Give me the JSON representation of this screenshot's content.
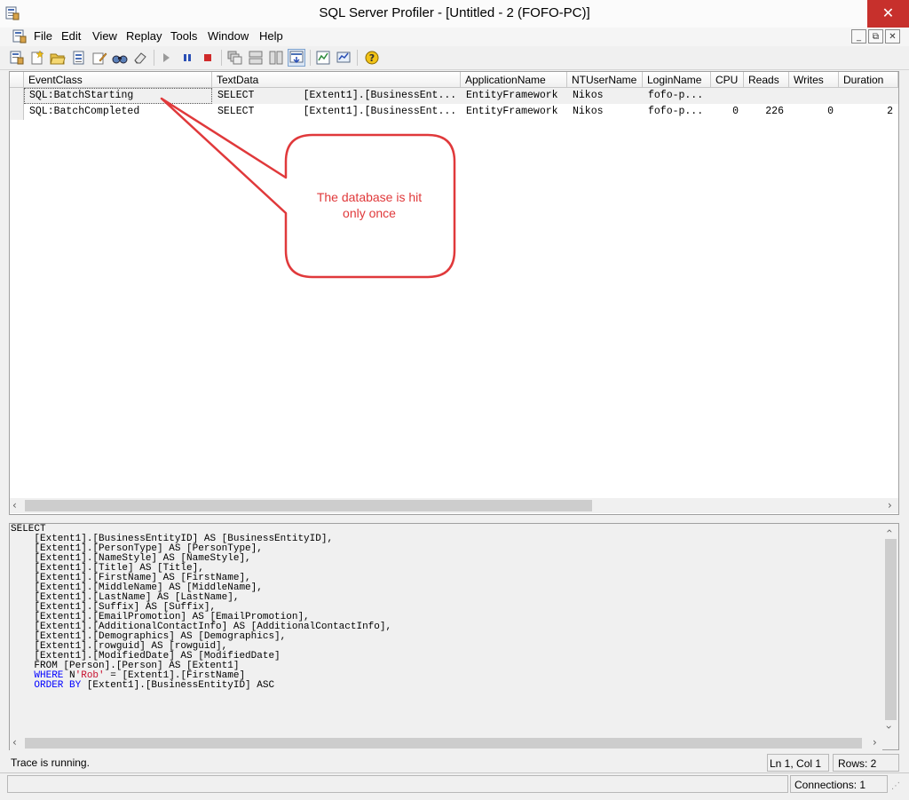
{
  "window": {
    "title": "SQL Server Profiler - [Untitled - 2 (FOFO-PC)]",
    "close_glyph": "✕"
  },
  "menu": {
    "items": [
      "File",
      "Edit",
      "View",
      "Replay",
      "Tools",
      "Window",
      "Help"
    ],
    "mdi_buttons": [
      "_",
      "⧉",
      "✕"
    ]
  },
  "toolbar": {
    "icons": [
      "new-trace-icon",
      "new-template-icon",
      "open-icon",
      "properties-icon",
      "find-icon",
      "clear-icon",
      "run-icon",
      "pause-icon",
      "stop-icon",
      "auto-scroll-icon",
      "help-icon"
    ]
  },
  "grid": {
    "columns": [
      "EventClass",
      "TextData",
      "ApplicationName",
      "NTUserName",
      "LoginName",
      "CPU",
      "Reads",
      "Writes",
      "Duration"
    ],
    "rows": [
      {
        "event_class": "SQL:BatchStarting",
        "text_data": "SELECT        [Extent1].[BusinessEnt...",
        "application_name": "EntityFramework",
        "nt_user_name": "Nikos",
        "login_name": "fofo-p...",
        "cpu": "",
        "reads": "",
        "writes": "",
        "duration": ""
      },
      {
        "event_class": "SQL:BatchCompleted",
        "text_data": "SELECT        [Extent1].[BusinessEnt...",
        "application_name": "EntityFramework",
        "nt_user_name": "Nikos",
        "login_name": "fofo-p...",
        "cpu": "0",
        "reads": "226",
        "writes": "0",
        "duration": "2"
      }
    ]
  },
  "callout": {
    "text_line1": "The database is hit",
    "text_line2": "only once",
    "color": "#e0393b"
  },
  "sql_text": [
    {
      "indent": "",
      "parts": [
        [
          "plain",
          "SELECT"
        ]
      ]
    },
    {
      "indent": "    ",
      "parts": [
        [
          "plain",
          "[Extent1].[BusinessEntityID] AS [BusinessEntityID],"
        ]
      ]
    },
    {
      "indent": "    ",
      "parts": [
        [
          "plain",
          "[Extent1].[PersonType] AS [PersonType],"
        ]
      ]
    },
    {
      "indent": "    ",
      "parts": [
        [
          "plain",
          "[Extent1].[NameStyle] AS [NameStyle],"
        ]
      ]
    },
    {
      "indent": "    ",
      "parts": [
        [
          "plain",
          "[Extent1].[Title] AS [Title],"
        ]
      ]
    },
    {
      "indent": "    ",
      "parts": [
        [
          "plain",
          "[Extent1].[FirstName] AS [FirstName],"
        ]
      ]
    },
    {
      "indent": "    ",
      "parts": [
        [
          "plain",
          "[Extent1].[MiddleName] AS [MiddleName],"
        ]
      ]
    },
    {
      "indent": "    ",
      "parts": [
        [
          "plain",
          "[Extent1].[LastName] AS [LastName],"
        ]
      ]
    },
    {
      "indent": "    ",
      "parts": [
        [
          "plain",
          "[Extent1].[Suffix] AS [Suffix],"
        ]
      ]
    },
    {
      "indent": "    ",
      "parts": [
        [
          "plain",
          "[Extent1].[EmailPromotion] AS [EmailPromotion],"
        ]
      ]
    },
    {
      "indent": "    ",
      "parts": [
        [
          "plain",
          "[Extent1].[AdditionalContactInfo] AS [AdditionalContactInfo],"
        ]
      ]
    },
    {
      "indent": "    ",
      "parts": [
        [
          "plain",
          "[Extent1].[Demographics] AS [Demographics],"
        ]
      ]
    },
    {
      "indent": "    ",
      "parts": [
        [
          "plain",
          "[Extent1].[rowguid] AS [rowguid],"
        ]
      ]
    },
    {
      "indent": "    ",
      "parts": [
        [
          "plain",
          "[Extent1].[ModifiedDate] AS [ModifiedDate]"
        ]
      ]
    },
    {
      "indent": "    ",
      "parts": [
        [
          "plain",
          "FROM [Person].[Person] AS [Extent1]"
        ]
      ]
    },
    {
      "indent": "    ",
      "parts": [
        [
          "keyword",
          "WHERE"
        ],
        [
          "plain",
          " N"
        ],
        [
          "string",
          "'Rob'"
        ],
        [
          "plain",
          " = [Extent1].[FirstName]"
        ]
      ]
    },
    {
      "indent": "    ",
      "parts": [
        [
          "keyword",
          "ORDER BY"
        ],
        [
          "plain",
          " [Extent1].[BusinessEntityID] ASC"
        ]
      ]
    }
  ],
  "sql_colors": {
    "plain": "#000000",
    "keyword": "#0000ff",
    "string": "#c8102e"
  },
  "status": {
    "message": "Trace is running.",
    "position": "Ln 1, Col 1",
    "rows": "Rows: 2",
    "connections": "Connections: 1"
  }
}
